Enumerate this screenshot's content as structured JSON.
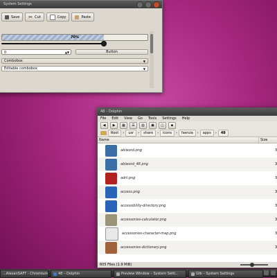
{
  "settings_window": {
    "title": "System Settings",
    "toolbar": {
      "save_label": "Save",
      "cut_label": "Cut",
      "copy_label": "Copy",
      "paste_label": "Paste"
    },
    "progress_text": "70%",
    "progress_value": 0.7,
    "slider_value": 1.0,
    "spin_value": "0",
    "button_label": "Button",
    "combobox_value": "Combobox",
    "editable_combobox_value": "Editable combobox"
  },
  "dolphin_window": {
    "title": "48 – Dolphin",
    "menu": [
      "File",
      "Edit",
      "View",
      "Go",
      "Tools",
      "Settings",
      "Help"
    ],
    "breadcrumbs": [
      "Root",
      "usr",
      "share",
      "icons",
      "faenza",
      "apps",
      "48"
    ],
    "columns": {
      "name": "Name",
      "size": "Size"
    },
    "files": [
      {
        "name": "abiword.png",
        "size": "3",
        "icon": "abiword-icon",
        "color": "#3a6ea5"
      },
      {
        "name": "abiword_48.png",
        "size": "3",
        "icon": "abiword-icon",
        "color": "#3a6ea5"
      },
      {
        "name": "adrt.png",
        "size": "3",
        "icon": "adrt-icon",
        "color": "#b32020"
      },
      {
        "name": "access.png",
        "size": "3",
        "icon": "accessibility-icon",
        "color": "#2a64b8"
      },
      {
        "name": "accessibility-directory.png",
        "size": "3",
        "icon": "accessibility-icon",
        "color": "#2a64b8"
      },
      {
        "name": "accessories-calculator.png",
        "size": "3",
        "icon": "calculator-icon",
        "color": "#9a9478"
      },
      {
        "name": "accessories-character-map.png",
        "size": "3",
        "icon": "character-map-icon",
        "color": "#e8e8e8"
      },
      {
        "name": "accessories-dictionary.png",
        "size": "3",
        "icon": "dictionary-icon",
        "color": "#a0623a"
      }
    ],
    "status": "605 Files (1.9 MiB)"
  },
  "taskbar": {
    "tasks": [
      "...AlexanSAFT - Chromium",
      "48 – Dolphin",
      "Preview Window – System Setti...",
      "Gtk – System Settings"
    ]
  }
}
